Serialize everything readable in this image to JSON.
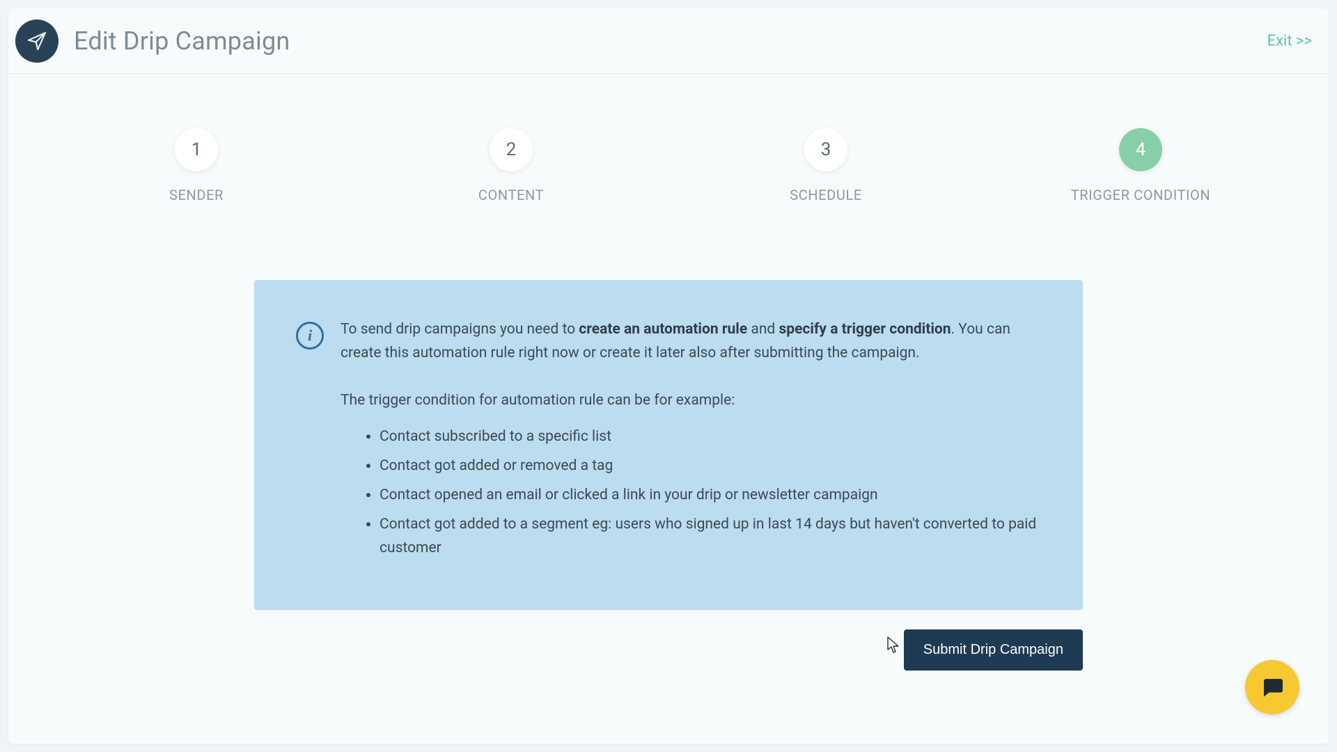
{
  "header": {
    "title": "Edit Drip Campaign",
    "exit_label": "Exit >>"
  },
  "stepper": {
    "active_index": 3,
    "steps": [
      {
        "number": "1",
        "label": "SENDER"
      },
      {
        "number": "2",
        "label": "CONTENT"
      },
      {
        "number": "3",
        "label": "SCHEDULE"
      },
      {
        "number": "4",
        "label": "TRIGGER CONDITION"
      }
    ]
  },
  "info": {
    "p1_pre": "To send drip campaigns you need to ",
    "p1_bold1": "create an automation rule",
    "p1_mid": " and ",
    "p1_bold2": "specify a trigger condition",
    "p1_post": ". You can create this automation rule right now or create it later also after submitting the campaign.",
    "p2": "The trigger condition for automation rule can be for example:",
    "bullets": [
      "Contact subscribed to a specific list",
      "Contact got added or removed a tag",
      "Contact opened an email or clicked a link in your drip or newsletter campaign",
      "Contact got added to a segment eg: users who signed up in last 14 days but haven't converted to paid customer"
    ]
  },
  "actions": {
    "submit_label": "Submit Drip Campaign"
  },
  "info_glyph": "i"
}
